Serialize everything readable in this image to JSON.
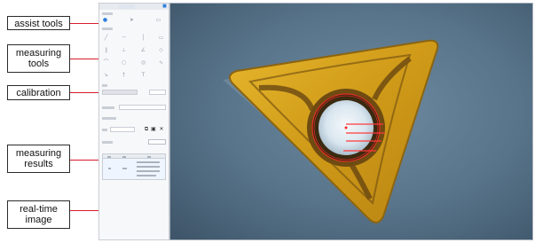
{
  "callouts": {
    "assist_tools": "assist  tools",
    "measuring_tools": [
      "measuring",
      "tools"
    ],
    "calibration": "calibration",
    "measuring_results": [
      "measuring",
      "results"
    ],
    "real_time_image": [
      "real-time",
      "image"
    ]
  },
  "colors": {
    "leader": "#d51d2b",
    "annotation_text": "#ff3b3b",
    "insert_gold": "#d4a21c",
    "background_surface": "#4e6a80"
  }
}
